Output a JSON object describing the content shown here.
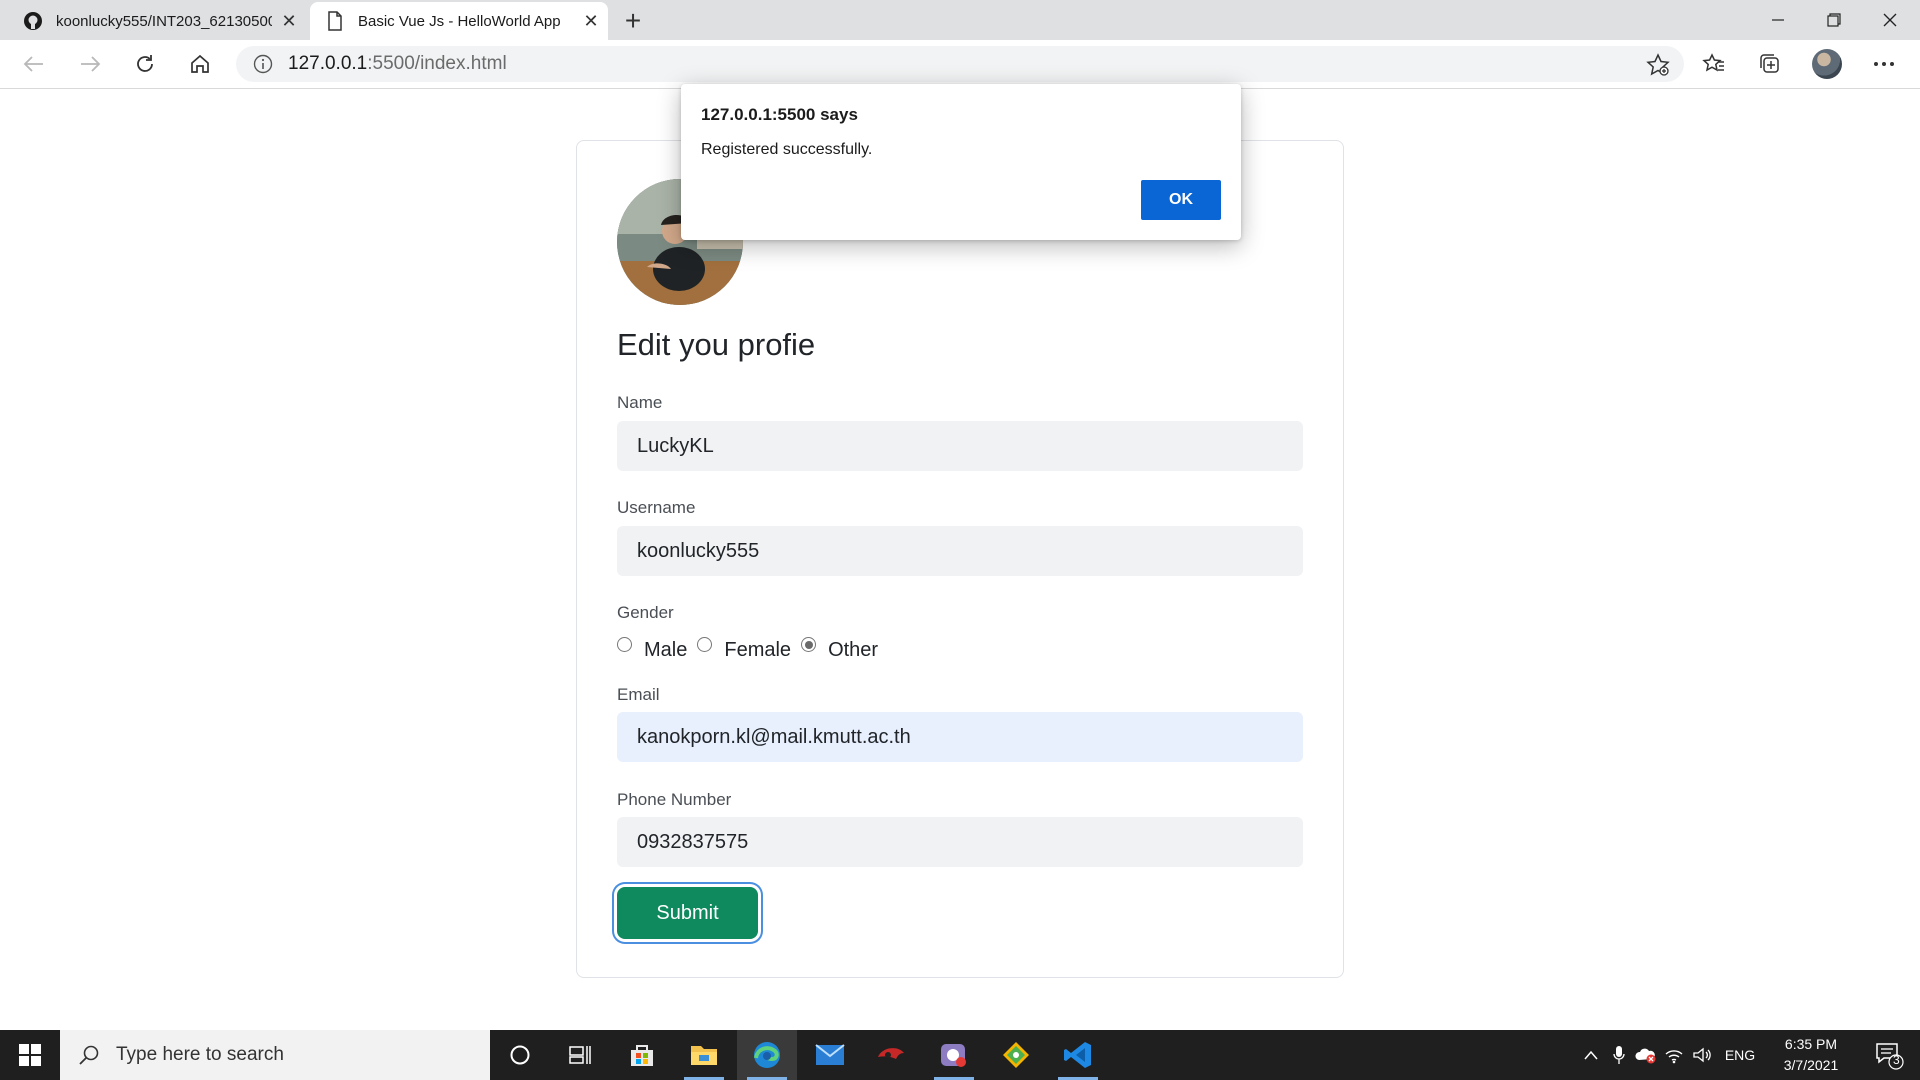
{
  "browser": {
    "tabs": [
      {
        "title": "koonlucky555/INT203_62130500",
        "active": false
      },
      {
        "title": "Basic Vue Js - HelloWorld App",
        "active": true
      }
    ],
    "url_host": "127.0.0.1",
    "url_path": ":5500/index.html"
  },
  "form": {
    "heading": "Edit you profie",
    "name_label": "Name",
    "name_value": "LuckyKL",
    "username_label": "Username",
    "username_value": "koonlucky555",
    "gender_label": "Gender",
    "gender_options": [
      "Male",
      "Female",
      "Other"
    ],
    "gender_selected": "Other",
    "email_label": "Email",
    "email_value": "kanokporn.kl@mail.kmutt.ac.th",
    "phone_label": "Phone Number",
    "phone_value": "0932837575",
    "submit_label": "Submit"
  },
  "alert": {
    "title": "127.0.0.1:5500 says",
    "message": "Registered successfully.",
    "ok_label": "OK"
  },
  "taskbar": {
    "search_placeholder": "Type here to search",
    "language": "ENG",
    "time": "6:35 PM",
    "date": "3/7/2021",
    "notification_count": "3"
  },
  "colors": {
    "submit": "#0f8a5f",
    "ok_button": "#0a66d4",
    "email_focus_bg": "#e8f0fe"
  }
}
